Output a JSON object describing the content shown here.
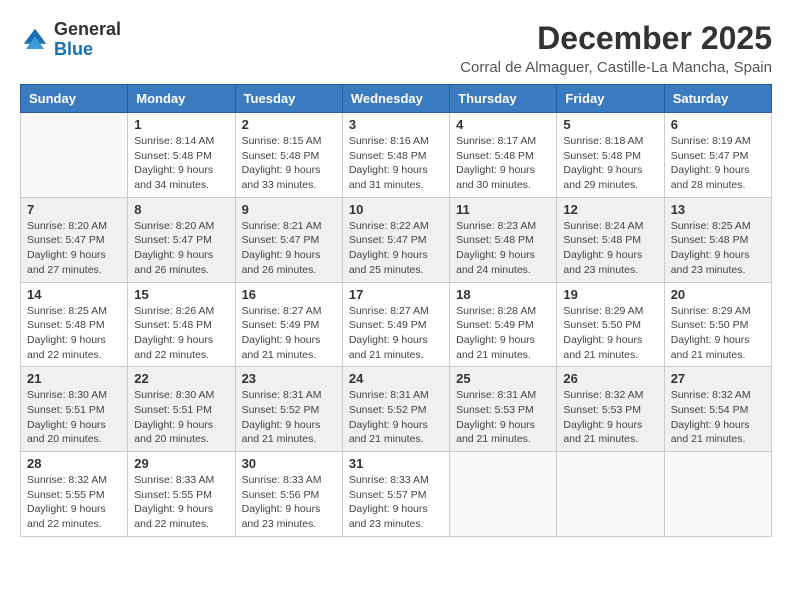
{
  "logo": {
    "text_general": "General",
    "text_blue": "Blue"
  },
  "header": {
    "title": "December 2025",
    "subtitle": "Corral de Almaguer, Castille-La Mancha, Spain"
  },
  "weekdays": [
    "Sunday",
    "Monday",
    "Tuesday",
    "Wednesday",
    "Thursday",
    "Friday",
    "Saturday"
  ],
  "weeks": [
    [
      {
        "day": "",
        "empty": true
      },
      {
        "day": "1",
        "sunrise": "Sunrise: 8:14 AM",
        "sunset": "Sunset: 5:48 PM",
        "daylight": "Daylight: 9 hours and 34 minutes."
      },
      {
        "day": "2",
        "sunrise": "Sunrise: 8:15 AM",
        "sunset": "Sunset: 5:48 PM",
        "daylight": "Daylight: 9 hours and 33 minutes."
      },
      {
        "day": "3",
        "sunrise": "Sunrise: 8:16 AM",
        "sunset": "Sunset: 5:48 PM",
        "daylight": "Daylight: 9 hours and 31 minutes."
      },
      {
        "day": "4",
        "sunrise": "Sunrise: 8:17 AM",
        "sunset": "Sunset: 5:48 PM",
        "daylight": "Daylight: 9 hours and 30 minutes."
      },
      {
        "day": "5",
        "sunrise": "Sunrise: 8:18 AM",
        "sunset": "Sunset: 5:48 PM",
        "daylight": "Daylight: 9 hours and 29 minutes."
      },
      {
        "day": "6",
        "sunrise": "Sunrise: 8:19 AM",
        "sunset": "Sunset: 5:47 PM",
        "daylight": "Daylight: 9 hours and 28 minutes."
      }
    ],
    [
      {
        "day": "7",
        "sunrise": "Sunrise: 8:20 AM",
        "sunset": "Sunset: 5:47 PM",
        "daylight": "Daylight: 9 hours and 27 minutes."
      },
      {
        "day": "8",
        "sunrise": "Sunrise: 8:20 AM",
        "sunset": "Sunset: 5:47 PM",
        "daylight": "Daylight: 9 hours and 26 minutes."
      },
      {
        "day": "9",
        "sunrise": "Sunrise: 8:21 AM",
        "sunset": "Sunset: 5:47 PM",
        "daylight": "Daylight: 9 hours and 26 minutes."
      },
      {
        "day": "10",
        "sunrise": "Sunrise: 8:22 AM",
        "sunset": "Sunset: 5:47 PM",
        "daylight": "Daylight: 9 hours and 25 minutes."
      },
      {
        "day": "11",
        "sunrise": "Sunrise: 8:23 AM",
        "sunset": "Sunset: 5:48 PM",
        "daylight": "Daylight: 9 hours and 24 minutes."
      },
      {
        "day": "12",
        "sunrise": "Sunrise: 8:24 AM",
        "sunset": "Sunset: 5:48 PM",
        "daylight": "Daylight: 9 hours and 23 minutes."
      },
      {
        "day": "13",
        "sunrise": "Sunrise: 8:25 AM",
        "sunset": "Sunset: 5:48 PM",
        "daylight": "Daylight: 9 hours and 23 minutes."
      }
    ],
    [
      {
        "day": "14",
        "sunrise": "Sunrise: 8:25 AM",
        "sunset": "Sunset: 5:48 PM",
        "daylight": "Daylight: 9 hours and 22 minutes."
      },
      {
        "day": "15",
        "sunrise": "Sunrise: 8:26 AM",
        "sunset": "Sunset: 5:48 PM",
        "daylight": "Daylight: 9 hours and 22 minutes."
      },
      {
        "day": "16",
        "sunrise": "Sunrise: 8:27 AM",
        "sunset": "Sunset: 5:49 PM",
        "daylight": "Daylight: 9 hours and 21 minutes."
      },
      {
        "day": "17",
        "sunrise": "Sunrise: 8:27 AM",
        "sunset": "Sunset: 5:49 PM",
        "daylight": "Daylight: 9 hours and 21 minutes."
      },
      {
        "day": "18",
        "sunrise": "Sunrise: 8:28 AM",
        "sunset": "Sunset: 5:49 PM",
        "daylight": "Daylight: 9 hours and 21 minutes."
      },
      {
        "day": "19",
        "sunrise": "Sunrise: 8:29 AM",
        "sunset": "Sunset: 5:50 PM",
        "daylight": "Daylight: 9 hours and 21 minutes."
      },
      {
        "day": "20",
        "sunrise": "Sunrise: 8:29 AM",
        "sunset": "Sunset: 5:50 PM",
        "daylight": "Daylight: 9 hours and 21 minutes."
      }
    ],
    [
      {
        "day": "21",
        "sunrise": "Sunrise: 8:30 AM",
        "sunset": "Sunset: 5:51 PM",
        "daylight": "Daylight: 9 hours and 20 minutes."
      },
      {
        "day": "22",
        "sunrise": "Sunrise: 8:30 AM",
        "sunset": "Sunset: 5:51 PM",
        "daylight": "Daylight: 9 hours and 20 minutes."
      },
      {
        "day": "23",
        "sunrise": "Sunrise: 8:31 AM",
        "sunset": "Sunset: 5:52 PM",
        "daylight": "Daylight: 9 hours and 21 minutes."
      },
      {
        "day": "24",
        "sunrise": "Sunrise: 8:31 AM",
        "sunset": "Sunset: 5:52 PM",
        "daylight": "Daylight: 9 hours and 21 minutes."
      },
      {
        "day": "25",
        "sunrise": "Sunrise: 8:31 AM",
        "sunset": "Sunset: 5:53 PM",
        "daylight": "Daylight: 9 hours and 21 minutes."
      },
      {
        "day": "26",
        "sunrise": "Sunrise: 8:32 AM",
        "sunset": "Sunset: 5:53 PM",
        "daylight": "Daylight: 9 hours and 21 minutes."
      },
      {
        "day": "27",
        "sunrise": "Sunrise: 8:32 AM",
        "sunset": "Sunset: 5:54 PM",
        "daylight": "Daylight: 9 hours and 21 minutes."
      }
    ],
    [
      {
        "day": "28",
        "sunrise": "Sunrise: 8:32 AM",
        "sunset": "Sunset: 5:55 PM",
        "daylight": "Daylight: 9 hours and 22 minutes."
      },
      {
        "day": "29",
        "sunrise": "Sunrise: 8:33 AM",
        "sunset": "Sunset: 5:55 PM",
        "daylight": "Daylight: 9 hours and 22 minutes."
      },
      {
        "day": "30",
        "sunrise": "Sunrise: 8:33 AM",
        "sunset": "Sunset: 5:56 PM",
        "daylight": "Daylight: 9 hours and 23 minutes."
      },
      {
        "day": "31",
        "sunrise": "Sunrise: 8:33 AM",
        "sunset": "Sunset: 5:57 PM",
        "daylight": "Daylight: 9 hours and 23 minutes."
      },
      {
        "day": "",
        "empty": true
      },
      {
        "day": "",
        "empty": true
      },
      {
        "day": "",
        "empty": true
      }
    ]
  ]
}
